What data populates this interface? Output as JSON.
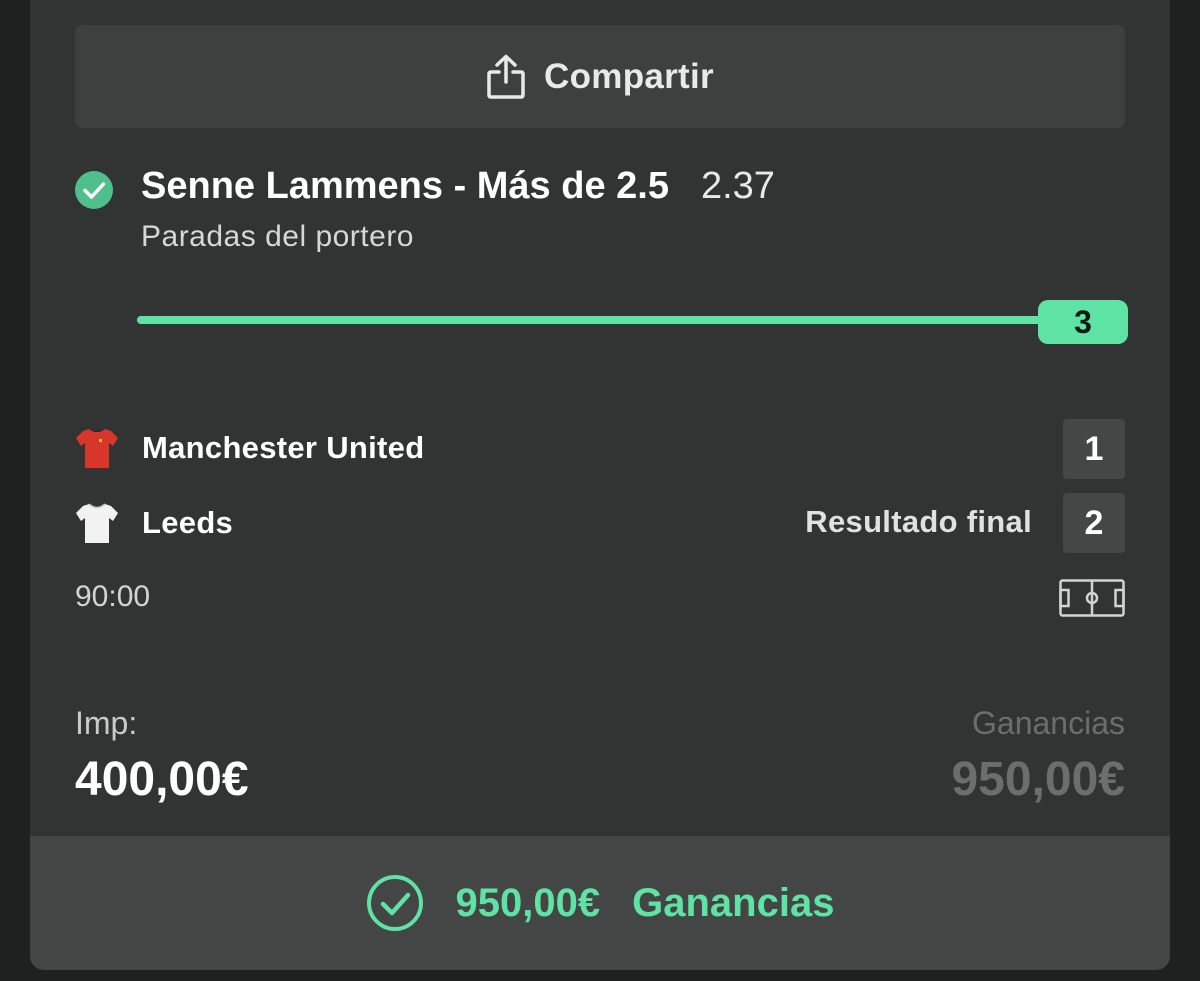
{
  "share": {
    "label": "Compartir",
    "icon": "share-icon"
  },
  "bet": {
    "status_icon": "check-circle-icon",
    "status_color": "#4fbf8b",
    "selection": "Senne Lammens - Más de 2.5",
    "odds": "2.37",
    "market": "Paradas del portero",
    "progress": {
      "current_value": "3",
      "line": 2.5,
      "fill_fraction": 1.0,
      "color": "#5ee3a4"
    }
  },
  "match": {
    "home": {
      "name": "Manchester United",
      "score": "1",
      "shirt_icon": "red-shirt-icon",
      "shirt_color": "#d9362b"
    },
    "away": {
      "name": "Leeds",
      "score": "2",
      "shirt_icon": "white-shirt-icon",
      "shirt_color": "#f2f2f2"
    },
    "result_label": "Resultado final",
    "time": "90:00",
    "pitch_icon": "pitch-icon"
  },
  "stake": {
    "label": "Imp:",
    "value": "400,00€"
  },
  "winnings": {
    "label": "Ganancias",
    "value": "950,00€"
  },
  "footer": {
    "amount": "950,00€",
    "label": "Ganancias",
    "icon": "check-circle-icon",
    "accent": "#5ee3a4"
  }
}
